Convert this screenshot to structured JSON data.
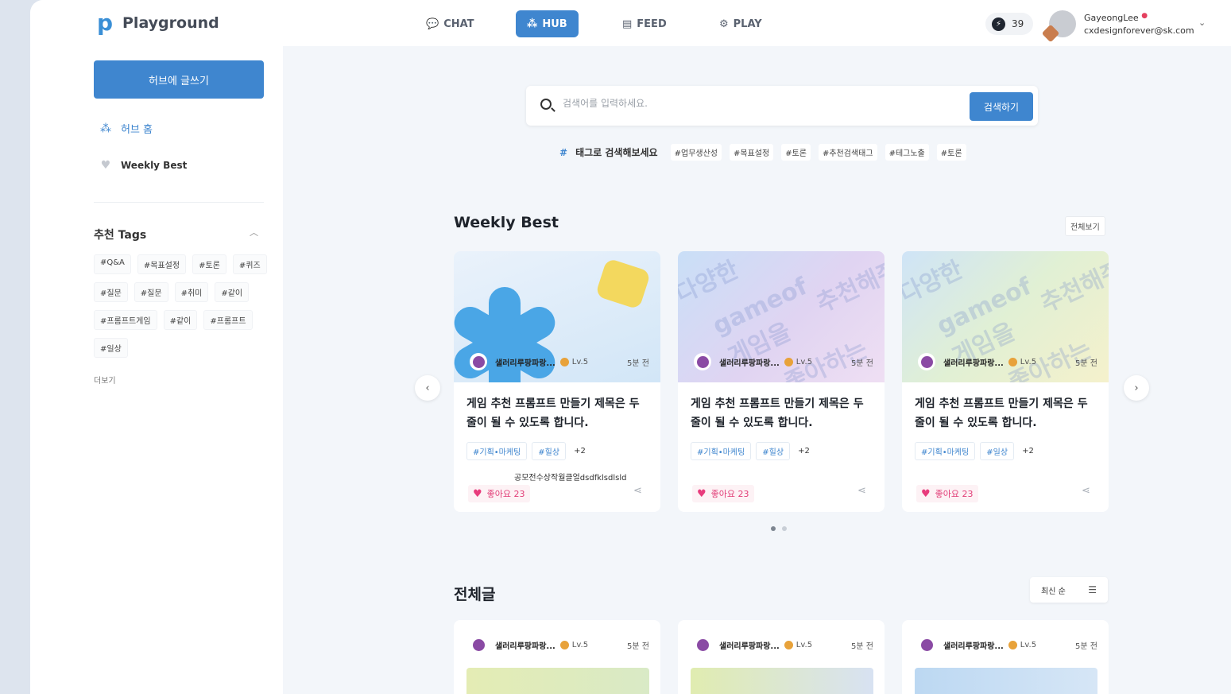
{
  "header": {
    "logo_text": "Playground",
    "nav": [
      {
        "label": "CHAT",
        "icon": "chat-icon",
        "active": false
      },
      {
        "label": "HUB",
        "icon": "hub-icon",
        "active": true
      },
      {
        "label": "FEED",
        "icon": "feed-icon",
        "active": false
      },
      {
        "label": "PLAY",
        "icon": "gear-icon",
        "active": false
      }
    ],
    "points": "39",
    "user": {
      "name": "GayeongLee",
      "email": "cxdesignforever@sk.com"
    }
  },
  "sidebar": {
    "write_button": "허브에 글쓰기",
    "items": [
      {
        "label": "허브 홈",
        "icon": "hub-home-icon",
        "active": true
      },
      {
        "label": "Weekly Best",
        "icon": "heart-icon",
        "active": false
      }
    ],
    "tags_title": "추천 Tags",
    "tags": [
      "#Q&A",
      "#목표설정",
      "#토론",
      "#퀴즈",
      "#질문",
      "#질문",
      "#취미",
      "#같이",
      "#프롬프트게임",
      "#같이",
      "#프롬프트",
      "#일상"
    ],
    "more_label": "더보기"
  },
  "search": {
    "placeholder": "검색어를 입력하세요.",
    "button_label": "검색하기",
    "tag_prompt": "태그로 검색해보세요",
    "tags": [
      "#업무생산성",
      "#목표설정",
      "#토론",
      "#추천검색태그",
      "#테그노출",
      "#토론"
    ]
  },
  "weekly_best": {
    "title": "Weekly Best",
    "view_all": "전체보기",
    "cards": [
      {
        "author": "샐러리루팡파랑...",
        "level": "Lv.5",
        "time": "5분 전",
        "title": "게임 추천 프롬프트 만들기 제목은 두줄이 될 수 있도록 합니다.",
        "tags": [
          "#기획•마케팅",
          "#힐상"
        ],
        "more_tags": "+2",
        "likes": "좋아요 23",
        "tooltip": "공모전수상작월클얼dsdfklsdlsld"
      },
      {
        "author": "샐러리루팡파랑...",
        "level": "Lv.5",
        "time": "5분 전",
        "title": "게임 추천 프롬프트 만들기 제목은 두줄이 될 수 있도록 합니다.",
        "tags": [
          "#기획•마케팅",
          "#힐상"
        ],
        "more_tags": "+2",
        "likes": "좋아요 23"
      },
      {
        "author": "샐러리루팡파랑...",
        "level": "Lv.5",
        "time": "5분 전",
        "title": "게임 추천 프롬프트 만들기 제목은 두줄이 될 수 있도록 합니다.",
        "tags": [
          "#기획•마케팅",
          "#일상"
        ],
        "more_tags": "+2",
        "likes": "좋아요 23"
      }
    ],
    "thumb_text": [
      "다양한",
      "gameof",
      "게임을",
      "추천해줘",
      "좋아하는"
    ]
  },
  "all_posts": {
    "title": "전체글",
    "sort_label": "최신 순",
    "cards": [
      {
        "author": "샐러리루팡파랑...",
        "level": "Lv.5",
        "time": "5분 전"
      },
      {
        "author": "샐러리루팡파랑...",
        "level": "Lv.5",
        "time": "5분 전"
      },
      {
        "author": "샐러리루팡파랑...",
        "level": "Lv.5",
        "time": "5분 전"
      }
    ]
  },
  "colors": {
    "accent": "#3f86cf",
    "like": "#e23e78"
  }
}
